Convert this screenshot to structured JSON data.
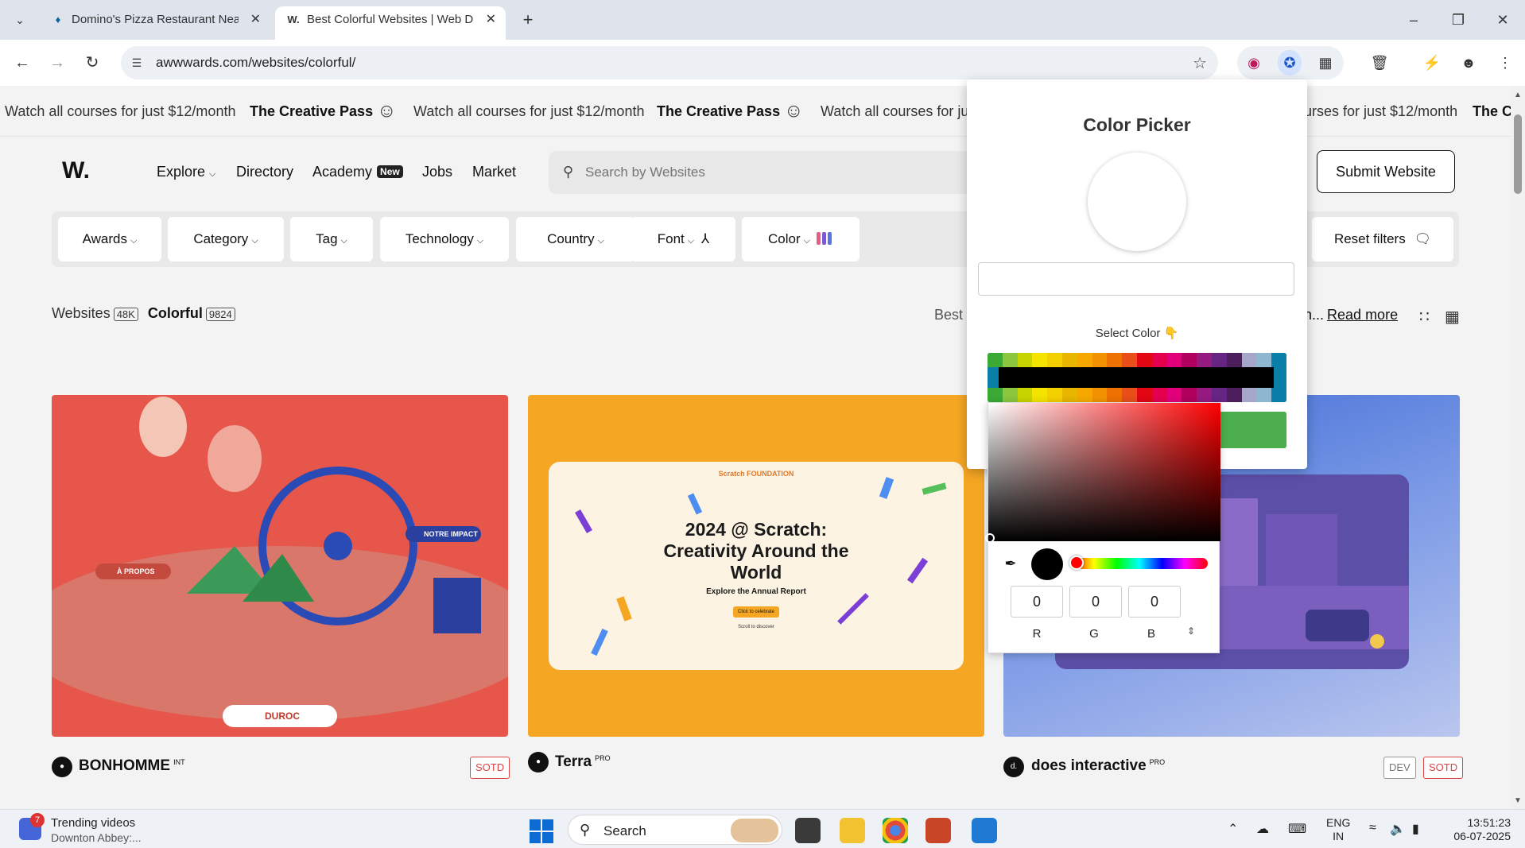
{
  "browser": {
    "tabs": [
      {
        "title": "Domino's Pizza Restaurant Nea",
        "favicon": "dominos-logo"
      },
      {
        "title": "Best Colorful Websites | Web De",
        "favicon": "W."
      }
    ],
    "url": "awwwards.com/websites/colorful/"
  },
  "marquee": {
    "course_text": "Watch all courses for just $12/month",
    "pass_text": "The Creative Pass",
    "truncated_left": "Watch all courses for jus",
    "truncated_right": "urses for just $12/month",
    "truncated_pass": "The Cr"
  },
  "header": {
    "logo": "W.",
    "nav": {
      "explore": "Explore",
      "directory": "Directory",
      "academy": "Academy",
      "academy_badge": "New",
      "jobs": "Jobs",
      "market": "Market"
    },
    "search_placeholder": "Search by Websites",
    "submit_label": "Submit Website"
  },
  "filters": {
    "awards": "Awards",
    "category": "Category",
    "tag": "Tag",
    "technology": "Technology",
    "country": "Country",
    "font": "Font",
    "color": "Color",
    "reset": "Reset filters"
  },
  "listing": {
    "websites_label": "Websites",
    "websites_count": "48K",
    "colorful_label": "Colorful",
    "colorful_count": "9824",
    "best_prefix": "Best s",
    "desc_suffix": "on...",
    "read_more": "Read more"
  },
  "cards": [
    {
      "name": "BONHOMME",
      "tag": "INT",
      "badges": [
        "SOTD"
      ],
      "inner_top": "À PROPOS",
      "inner_right": "NOTRE IMPACT",
      "inner_bottom": "DUROC"
    },
    {
      "name": "Terra",
      "tag": "PRO",
      "badges": [],
      "headline": "2024 @ Scratch: Creativity Around the World",
      "sub": "Explore the Annual Report",
      "cta": "Click to celebrate",
      "scroll": "Scroll to discover",
      "brand": "Scratch FOUNDATION"
    },
    {
      "name": "does interactive",
      "tag": "PRO",
      "badges": [
        "DEV",
        "SOTD"
      ]
    }
  ],
  "color_picker": {
    "title": "Color Picker",
    "hex_value": "",
    "select_label": "Select Color 👇",
    "swatches": [
      "#3aaa35",
      "#8cc63f",
      "#c8d400",
      "#f5e400",
      "#f5d000",
      "#e8b600",
      "#f6a800",
      "#f39200",
      "#ee7203",
      "#e94e1b",
      "#e30613",
      "#e5004f",
      "#e2007a",
      "#b1005d",
      "#951b81",
      "#662483",
      "#4c1e5c",
      "#a6a6c8",
      "#8fb8d0",
      "#0a7fa8"
    ],
    "selected_color": "#000000",
    "r": "0",
    "g": "0",
    "b": "0",
    "r_label": "R",
    "g_label": "G",
    "b_label": "B",
    "hue_color": "#ff0000"
  },
  "taskbar": {
    "news_count": "7",
    "news_title": "Trending videos",
    "news_sub": "Downton Abbey:...",
    "search_label": "Search",
    "lang_top": "ENG",
    "lang_bottom": "IN",
    "time": "13:51:23",
    "date": "06-07-2025"
  }
}
